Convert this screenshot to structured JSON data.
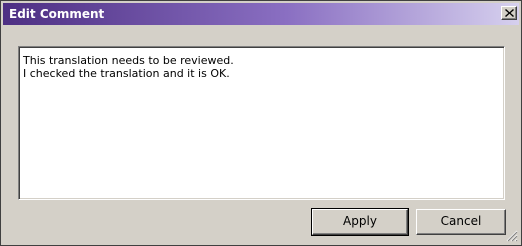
{
  "window": {
    "title": "Edit Comment"
  },
  "titlebar": {
    "close_icon": "close-icon",
    "gradient_colors": [
      "#4d2f83",
      "#8a6fc2",
      "#d6d0ee"
    ]
  },
  "comment": {
    "lines": [
      "This translation needs to be reviewed.",
      "I checked the translation and it is OK."
    ]
  },
  "buttons": {
    "apply_label": "Apply",
    "cancel_label": "Cancel"
  },
  "colors": {
    "dialog_face": "#d4d0c8",
    "text_area_background": "#ffffff"
  }
}
